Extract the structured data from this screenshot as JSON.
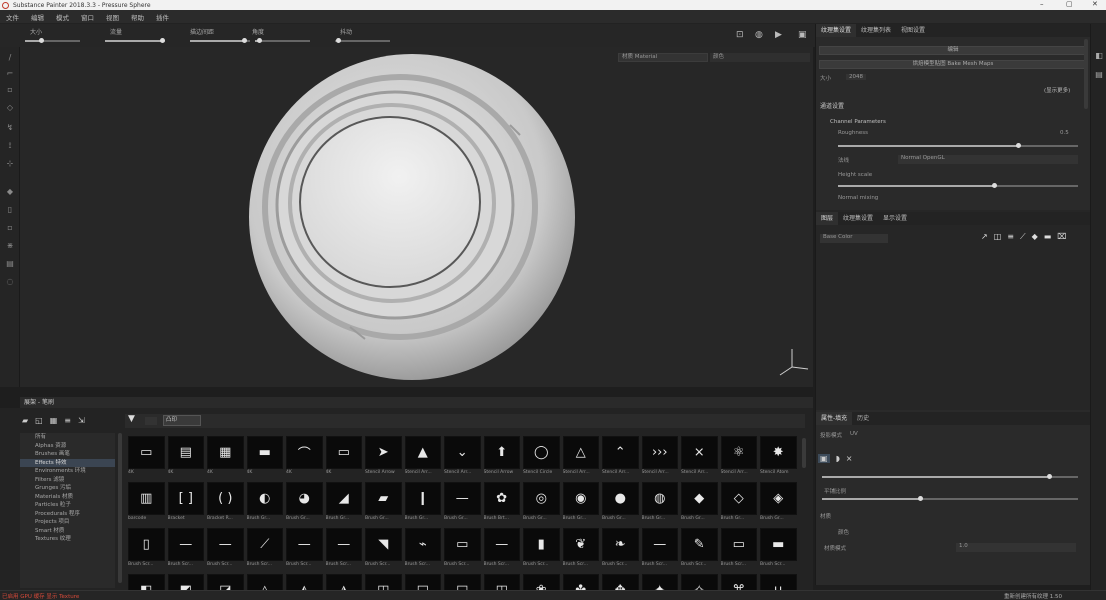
{
  "window": {
    "title": "Substance Painter 2018.3.3 - Pressure Sphere",
    "controls": [
      "–",
      "▢",
      "✕"
    ]
  },
  "menu": [
    "文件",
    "编辑",
    "模式",
    "窗口",
    "视图",
    "帮助",
    "插件"
  ],
  "tool_options": {
    "group1_label": "大小",
    "group2_label": "流量",
    "group3_label": "描边间距",
    "group4_label": "角度",
    "group5_label": "抖动"
  },
  "viewport": {
    "display_combo": "材质 Material",
    "layer_combo": "颜色"
  },
  "texture_set_panel": {
    "tabs": [
      "纹理集设置",
      "纹理集列表",
      "视图设置"
    ],
    "button1": "编辑",
    "button2": "烘焙模型贴图  Bake Mesh Maps",
    "size_label": "大小",
    "size_value": "2048",
    "size_value2": "2048",
    "section_label": "通道设置",
    "subsection": "Channel Parameters",
    "param1": "Roughness",
    "param1_value": "0.5",
    "normal_label": "法线",
    "normal_value": "Normal OpenGL",
    "param2": "Height scale",
    "param3": "Normal mixing",
    "link": "(显示更多)"
  },
  "layers_panel": {
    "tabs": [
      "图层",
      "纹理集设置",
      "显示设置"
    ],
    "blend_mode": "Base Color"
  },
  "properties_panel": {
    "tabs": [
      "属性-填充",
      "历史"
    ],
    "sub_label": "投影模式",
    "sub_value": "UV",
    "row1": "平铺比例",
    "row2": "材质",
    "row3": "颜色",
    "row4": "材质模式",
    "row4_value": "1.0"
  },
  "shelf": {
    "title": "展架 - 笔刷",
    "filter_text": "凸印",
    "tree": [
      "所有",
      "Alphas 资源",
      "Brushes 画笔",
      "Effects 特效",
      "Environments 环境",
      "Filters 滤镜",
      "Grunges 污垢",
      "Materials 材质",
      "Particles 粒子",
      "Procedurals 程序",
      "Projects 项目",
      "Smart 材质",
      "Textures 纹理"
    ],
    "selected_index": 3,
    "thumbs": [
      {
        "g": "▭",
        "c": "4K"
      },
      {
        "g": "▤",
        "c": "4K"
      },
      {
        "g": "▦",
        "c": "4K"
      },
      {
        "g": "▬",
        "c": "4K"
      },
      {
        "g": "⌒",
        "c": "4K"
      },
      {
        "g": "▭",
        "c": "4K"
      },
      {
        "g": "➤",
        "c": "Stencil Arrow"
      },
      {
        "g": "▲",
        "c": "Stencil Arr..."
      },
      {
        "g": "⌄",
        "c": "Stencil Arr..."
      },
      {
        "g": "⬆",
        "c": "Stencil Arrow"
      },
      {
        "g": "◯",
        "c": "Stencil Circle"
      },
      {
        "g": "△",
        "c": "Stencil Arr..."
      },
      {
        "g": "⌃",
        "c": "Stencil Arr..."
      },
      {
        "g": "›››",
        "c": "Stencil Arr..."
      },
      {
        "g": "⨯",
        "c": "Stencil Arr..."
      },
      {
        "g": "⚛",
        "c": "Stencil Arr..."
      },
      {
        "g": "✸",
        "c": "Stencil Atom"
      },
      {
        "g": "▥",
        "c": "barcode"
      },
      {
        "g": "[ ]",
        "c": "Bracket"
      },
      {
        "g": "( )",
        "c": "Bracket R..."
      },
      {
        "g": "◐",
        "c": "Brush Gr..."
      },
      {
        "g": "◕",
        "c": "Brush Gr..."
      },
      {
        "g": "◢",
        "c": "Brush Gr..."
      },
      {
        "g": "▰",
        "c": "Brush Gr..."
      },
      {
        "g": "❙",
        "c": "Brush Gr..."
      },
      {
        "g": "—",
        "c": "Brush Gr..."
      },
      {
        "g": "✿",
        "c": "Brush Brt..."
      },
      {
        "g": "◎",
        "c": "Brush Gr..."
      },
      {
        "g": "◉",
        "c": "Brush Gr..."
      },
      {
        "g": "●",
        "c": "Brush Gr..."
      },
      {
        "g": "◍",
        "c": "Brush Gr..."
      },
      {
        "g": "◆",
        "c": "Brush Gr..."
      },
      {
        "g": "◇",
        "c": "Brush Gr..."
      },
      {
        "g": "◈",
        "c": "Brush Gr..."
      },
      {
        "g": "▯",
        "c": "Brush Scr..."
      },
      {
        "g": "—",
        "c": "Brush Scr..."
      },
      {
        "g": "—",
        "c": "Brush Scr..."
      },
      {
        "g": "⟋",
        "c": "Brush Scr..."
      },
      {
        "g": "—",
        "c": "Brush Scr..."
      },
      {
        "g": "—",
        "c": "Brush Scr..."
      },
      {
        "g": "◥",
        "c": "Brush Scr..."
      },
      {
        "g": "⌁",
        "c": "Brush Scr..."
      },
      {
        "g": "▭",
        "c": "Brush Scr..."
      },
      {
        "g": "—",
        "c": "Brush Scr..."
      },
      {
        "g": "▮",
        "c": "Brush Scr..."
      },
      {
        "g": "❦",
        "c": "Brush Scr..."
      },
      {
        "g": "❧",
        "c": "Brush Scr..."
      },
      {
        "g": "—",
        "c": "Brush Scr..."
      },
      {
        "g": "✎",
        "c": "Brush Scr..."
      },
      {
        "g": "▭",
        "c": "Brush Scr..."
      },
      {
        "g": "▬",
        "c": "Brush Scr..."
      },
      {
        "g": "◧",
        "c": ""
      },
      {
        "g": "◩",
        "c": ""
      },
      {
        "g": "◪",
        "c": ""
      },
      {
        "g": "◬",
        "c": ""
      },
      {
        "g": "◭",
        "c": ""
      },
      {
        "g": "◮",
        "c": ""
      },
      {
        "g": "◰",
        "c": ""
      },
      {
        "g": "◱",
        "c": ""
      },
      {
        "g": "◲",
        "c": ""
      },
      {
        "g": "◳",
        "c": ""
      },
      {
        "g": "❀",
        "c": ""
      },
      {
        "g": "✤",
        "c": ""
      },
      {
        "g": "✥",
        "c": ""
      },
      {
        "g": "✦",
        "c": ""
      },
      {
        "g": "✧",
        "c": ""
      },
      {
        "g": "⌘",
        "c": ""
      },
      {
        "g": "∪",
        "c": ""
      }
    ]
  },
  "status": {
    "left": "已启用 GPU 缓存    显示 Texture",
    "right": "重新创建所有纹理   1.50"
  }
}
